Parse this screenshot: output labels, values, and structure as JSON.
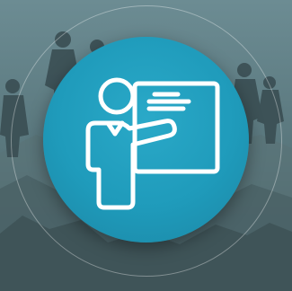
{
  "scene": {
    "background_color": "#4f6a72",
    "badge_color": "#1f9bbb",
    "icon_color": "#ffffff",
    "icon": "presenter-whiteboard-icon",
    "background": "photo-of-hikers-on-mountain-ridge"
  }
}
